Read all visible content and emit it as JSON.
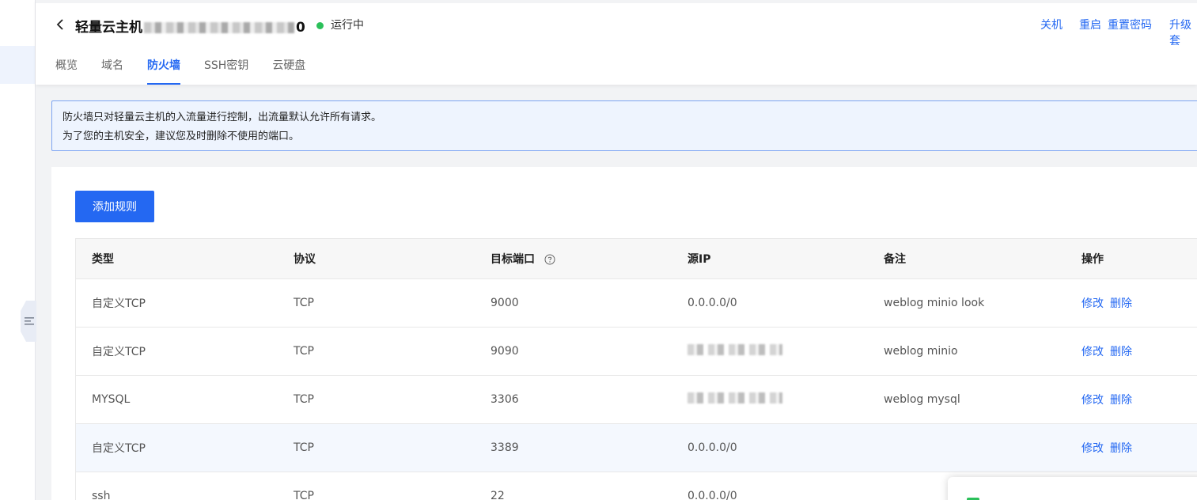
{
  "header": {
    "title_prefix": "轻量云主机",
    "title_suffix": "0",
    "status": "运行中",
    "status_color": "#2bc05a",
    "actions": [
      "关机",
      "重启",
      "重置密码",
      "升级套"
    ]
  },
  "tabs": [
    {
      "label": "概览"
    },
    {
      "label": "域名"
    },
    {
      "label": "防火墙",
      "active": true
    },
    {
      "label": "SSH密钥"
    },
    {
      "label": "云硬盘"
    }
  ],
  "notice": {
    "line1": "防火墙只对轻量云主机的入流量进行控制，出流量默认允许所有请求。",
    "line2": "为了您的主机安全，建议您及时删除不使用的端口。"
  },
  "add_button": "添加规则",
  "table": {
    "headers": [
      "类型",
      "协议",
      "目标端口",
      "源IP",
      "备注",
      "操作"
    ],
    "rows": [
      {
        "type": "自定义TCP",
        "protocol": "TCP",
        "port": "9000",
        "source": "0.0.0.0/0",
        "note": "weblog minio look"
      },
      {
        "type": "自定义TCP",
        "protocol": "TCP",
        "port": "9090",
        "source": "",
        "note": "weblog minio"
      },
      {
        "type": "MYSQL",
        "protocol": "TCP",
        "port": "3306",
        "source": "",
        "note": "weblog mysql"
      },
      {
        "type": "自定义TCP",
        "protocol": "TCP",
        "port": "3389",
        "source": "0.0.0.0/0",
        "note": ""
      },
      {
        "type": "ssh",
        "protocol": "TCP",
        "port": "22",
        "source": "0.0.0.0/0",
        "note": ""
      }
    ],
    "op_edit": "修改",
    "op_delete": "删除"
  },
  "colors": {
    "accent": "#2468f2",
    "notice_bg": "#eef4fe",
    "notice_border": "#7ca4f2"
  }
}
